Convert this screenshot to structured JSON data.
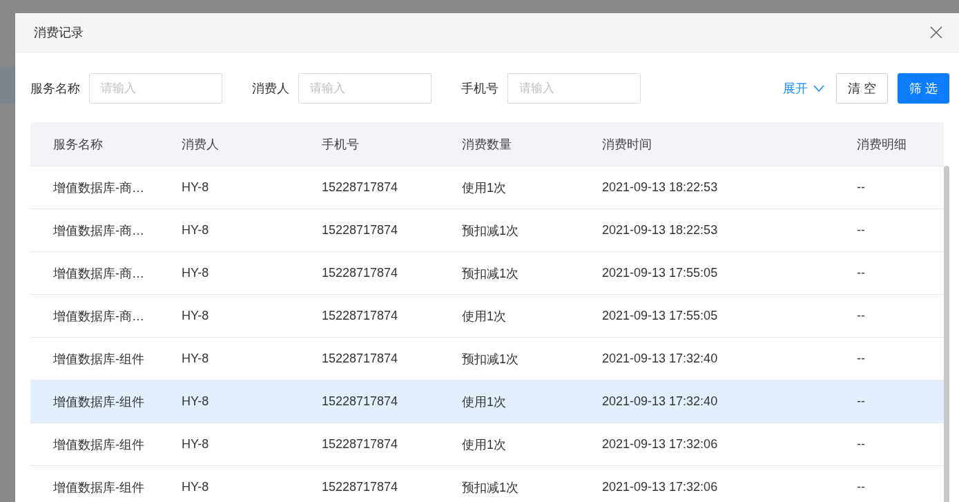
{
  "dialog": {
    "title": "消费记录"
  },
  "filters": [
    {
      "label": "服务名称",
      "placeholder": "请输入"
    },
    {
      "label": "消费人",
      "placeholder": "请输入"
    },
    {
      "label": "手机号",
      "placeholder": "请输入"
    }
  ],
  "expand_link": "展开",
  "buttons": [
    {
      "label": "清 空",
      "kind": "default"
    },
    {
      "label": "筛 选",
      "kind": "primary"
    }
  ],
  "table": {
    "columns": [
      "服务名称",
      "消费人",
      "手机号",
      "消费数量",
      "消费时间",
      "消费明细"
    ],
    "rows": [
      {
        "cells": [
          "增值数据库-商…",
          "HY-8",
          "15228717874",
          "使用1次",
          "2021-09-13 18:22:53",
          "--"
        ],
        "selected": false
      },
      {
        "cells": [
          "增值数据库-商…",
          "HY-8",
          "15228717874",
          "预扣减1次",
          "2021-09-13 18:22:53",
          "--"
        ],
        "selected": false
      },
      {
        "cells": [
          "增值数据库-商…",
          "HY-8",
          "15228717874",
          "预扣减1次",
          "2021-09-13 17:55:05",
          "--"
        ],
        "selected": false
      },
      {
        "cells": [
          "增值数据库-商…",
          "HY-8",
          "15228717874",
          "使用1次",
          "2021-09-13 17:55:05",
          "--"
        ],
        "selected": false
      },
      {
        "cells": [
          "增值数据库-组件",
          "HY-8",
          "15228717874",
          "预扣减1次",
          "2021-09-13 17:32:40",
          "--"
        ],
        "selected": false
      },
      {
        "cells": [
          "增值数据库-组件",
          "HY-8",
          "15228717874",
          "使用1次",
          "2021-09-13 17:32:40",
          "--"
        ],
        "selected": true
      },
      {
        "cells": [
          "增值数据库-组件",
          "HY-8",
          "15228717874",
          "使用1次",
          "2021-09-13 17:32:06",
          "--"
        ],
        "selected": false
      },
      {
        "cells": [
          "增值数据库-组件",
          "HY-8",
          "15228717874",
          "预扣减1次",
          "2021-09-13 17:32:06",
          "--"
        ],
        "selected": false
      }
    ]
  }
}
